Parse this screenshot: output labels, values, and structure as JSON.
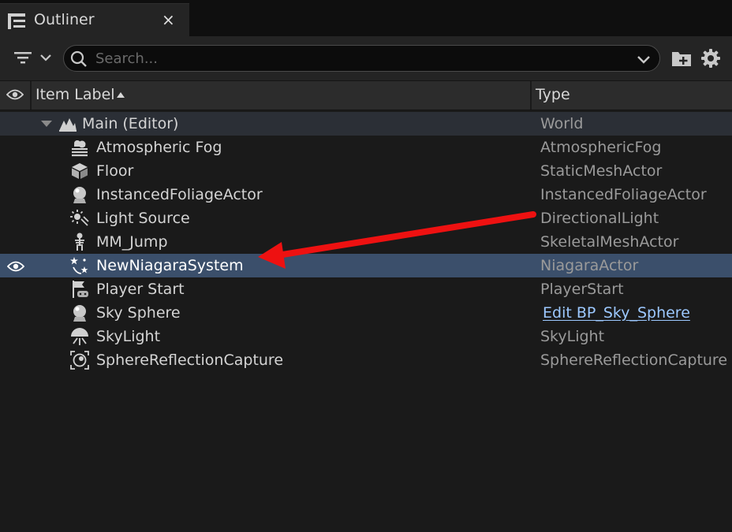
{
  "tab": {
    "title": "Outliner",
    "close": "×"
  },
  "toolbar": {
    "search_placeholder": "Search..."
  },
  "header": {
    "item_label": "Item Label",
    "type": "Type"
  },
  "rows": [
    {
      "label": "Main (Editor)",
      "type": "World",
      "icon": "world-icon"
    },
    {
      "label": "Atmospheric Fog",
      "type": "AtmosphericFog",
      "icon": "fog-icon"
    },
    {
      "label": "Floor",
      "type": "StaticMeshActor",
      "icon": "static-mesh-icon"
    },
    {
      "label": "InstancedFoliageActor",
      "type": "InstancedFoliageActor",
      "icon": "foliage-icon"
    },
    {
      "label": "Light Source",
      "type": "DirectionalLight",
      "icon": "directional-light-icon"
    },
    {
      "label": "MM_Jump",
      "type": "SkeletalMeshActor",
      "icon": "skeleton-icon"
    },
    {
      "label": "NewNiagaraSystem",
      "type": "NiagaraActor",
      "icon": "niagara-icon"
    },
    {
      "label": "Player Start",
      "type": "PlayerStart",
      "icon": "player-start-icon"
    },
    {
      "label": "Sky Sphere",
      "type": "Edit BP_Sky_Sphere",
      "icon": "sky-sphere-icon"
    },
    {
      "label": "SkyLight",
      "type": "SkyLight",
      "icon": "skylight-icon"
    },
    {
      "label": "SphereReflectionCapture",
      "type": "SphereReflectionCapture",
      "icon": "reflection-capture-icon"
    }
  ],
  "colors": {
    "selected_row": "#3b4f6b",
    "world_row": "#2b2f36",
    "link": "#9cc8ff",
    "annotation_arrow": "#ee1111"
  }
}
